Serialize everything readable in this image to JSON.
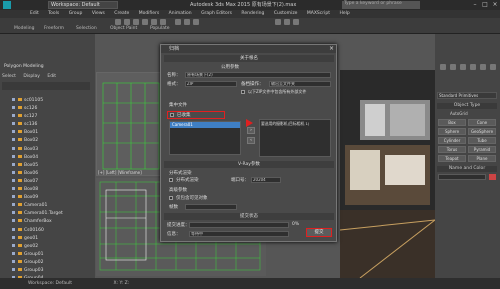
{
  "titlebar": {
    "workspace": "Workspace: Default",
    "app_title": "Autodesk 3ds Max 2015    原有场景下(2).max",
    "search_placeholder": "Type a keyword or phrase"
  },
  "menu": [
    "Edit",
    "Tools",
    "Group",
    "Views",
    "Create",
    "Modifiers",
    "Animation",
    "Graph Editors",
    "Rendering",
    "Customize",
    "MAXScript",
    "Help"
  ],
  "ribbon": {
    "tabs": [
      "Modeling",
      "Freeform",
      "Selection",
      "Object Paint",
      "Populate"
    ],
    "subtitle": "Polygon Modeling"
  },
  "scene_explorer": {
    "tabs": [
      "Select",
      "Display",
      "Edit"
    ],
    "items": [
      "sc01105",
      "sc126",
      "sc127",
      "sc136",
      "Box01",
      "Box02",
      "Box03",
      "Box04",
      "Box05",
      "Box06",
      "Box07",
      "Box08",
      "Box09",
      "Camera01",
      "Camera01.Target",
      "ChamferBox",
      "Cs00160",
      "geo01",
      "geo02",
      "Group01",
      "Group02",
      "Group03",
      "Group04",
      "Group05",
      "Group06",
      "Group07",
      "Group08",
      "Group09"
    ]
  },
  "viewports": {
    "top_label": "[+] [Top] [Wireframe]",
    "left_label": "[+] [Left] [Wireframe]"
  },
  "command_panel": {
    "dropdown": "Standard Primitives",
    "object_type": "Object Type",
    "autogrid": "AutoGrid",
    "buttons": [
      "Box",
      "Cone",
      "Sphere",
      "GeoSphere",
      "Cylinder",
      "Tube",
      "Torus",
      "Pyramid",
      "Teapot",
      "Plane"
    ],
    "name_color": "Name and Color"
  },
  "dialog": {
    "title": "归档",
    "section1": "关于根名",
    "group_sub": "公用参数",
    "label_name": "名称：",
    "name_value": "原有场景下(2)",
    "label_format": "格式：",
    "format_value": "ZIP",
    "label_archive": "备档操作：",
    "archive_value": "输出至文件夹",
    "chk_extra": "以下ZIP文件中包含所有外部文件",
    "section_collect": "集中文件",
    "chk_collect": "已收集",
    "cameras_label": "Camera01",
    "list_right_label": "要选用的摄影机(目标相机 1)",
    "section2": "V-Ray参数",
    "sub_dist": "分布式渲染",
    "chk_dist": "分布式渲染",
    "label_port": "端口号：",
    "port_value": "20204",
    "sub_adv": "高级参数",
    "chk_adv": "仅包含可见对象",
    "label_frames": "帧数",
    "section3": "提交状态",
    "status_label": "提交进度：",
    "progress_percent": "0%",
    "progress_value": 0,
    "info_label": "信息：",
    "info_value": "等待中",
    "submit_button": "提交",
    "close_glyph": "×"
  },
  "statusbar": {
    "workspace": "Workspace: Default",
    "coords": "X:  Y:  Z:"
  }
}
